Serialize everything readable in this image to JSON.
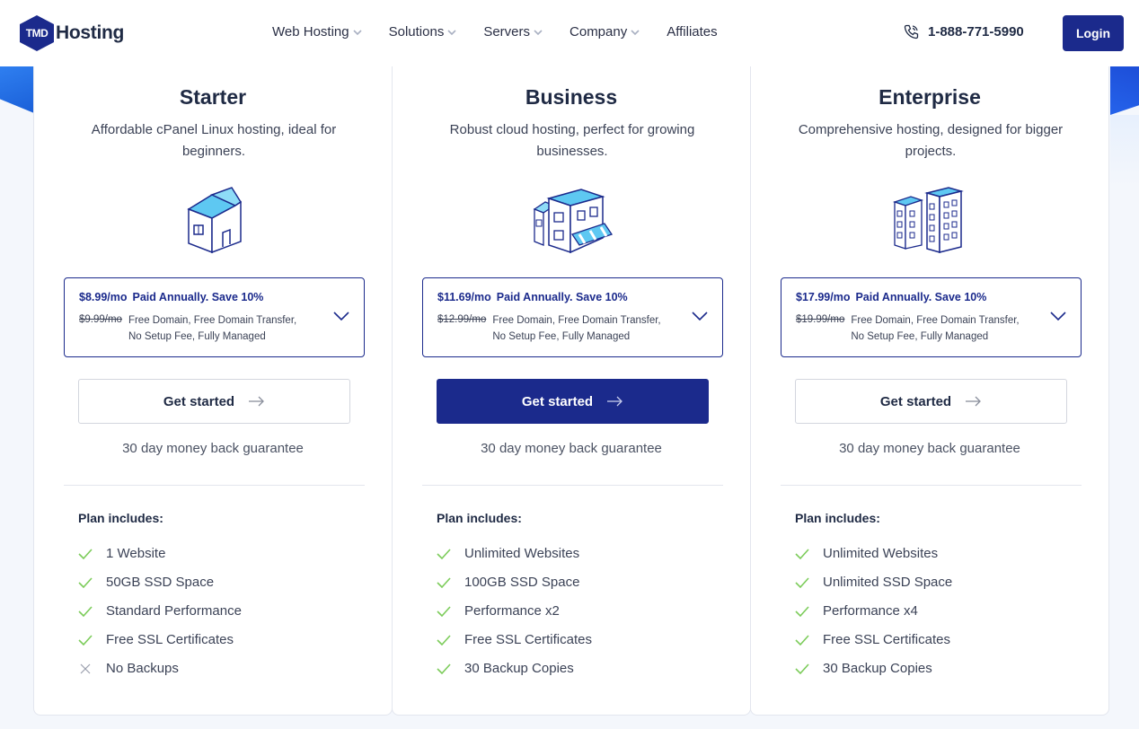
{
  "brand": {
    "logo_badge": "TMD",
    "logo_name": "Hosting"
  },
  "nav": [
    {
      "label": "Web Hosting",
      "has_dropdown": true
    },
    {
      "label": "Solutions",
      "has_dropdown": true
    },
    {
      "label": "Servers",
      "has_dropdown": true
    },
    {
      "label": "Company",
      "has_dropdown": true
    },
    {
      "label": "Affiliates",
      "has_dropdown": false
    }
  ],
  "phone": "1-888-771-5990",
  "login_label": "Login",
  "colors": {
    "brand": "#1b2a8c",
    "check": "#7ccc5a",
    "cross": "#9aa0ad"
  },
  "plans": [
    {
      "title": "Starter",
      "description": "Affordable cPanel Linux hosting, ideal for beginners.",
      "illustration": "house-icon",
      "price": "$8.99/mo",
      "billing": "Paid Annually. Save 10%",
      "old_price": "$9.99/mo",
      "perks": "Free Domain, Free Domain Transfer, No Setup Fee, Fully Managed",
      "cta": "Get started",
      "guarantee": "30 day money back guarantee",
      "includes_label": "Plan includes:",
      "features": [
        {
          "label": "1 Website",
          "included": true
        },
        {
          "label": "50GB SSD Space",
          "included": true
        },
        {
          "label": "Standard Performance",
          "included": true
        },
        {
          "label": "Free SSL Certificates",
          "included": true
        },
        {
          "label": "No Backups",
          "included": false
        }
      ]
    },
    {
      "title": "Business",
      "description": "Robust cloud hosting, perfect for growing businesses.",
      "illustration": "storefront-icon",
      "price": "$11.69/mo",
      "billing": "Paid Annually. Save 10%",
      "old_price": "$12.99/mo",
      "perks": "Free Domain, Free Domain Transfer, No Setup Fee, Fully Managed",
      "cta": "Get started",
      "guarantee": "30 day money back guarantee",
      "includes_label": "Plan includes:",
      "features": [
        {
          "label": "Unlimited Websites",
          "included": true
        },
        {
          "label": "100GB SSD Space",
          "included": true
        },
        {
          "label": "Performance x2",
          "included": true
        },
        {
          "label": "Free SSL Certificates",
          "included": true
        },
        {
          "label": "30 Backup Copies",
          "included": true
        }
      ]
    },
    {
      "title": "Enterprise",
      "description": "Comprehensive hosting, designed for bigger projects.",
      "illustration": "office-buildings-icon",
      "price": "$17.99/mo",
      "billing": "Paid Annually. Save 10%",
      "old_price": "$19.99/mo",
      "perks": "Free Domain, Free Domain Transfer, No Setup Fee, Fully Managed",
      "cta": "Get started",
      "guarantee": "30 day money back guarantee",
      "includes_label": "Plan includes:",
      "features": [
        {
          "label": "Unlimited Websites",
          "included": true
        },
        {
          "label": "Unlimited SSD Space",
          "included": true
        },
        {
          "label": "Performance x4",
          "included": true
        },
        {
          "label": "Free SSL Certificates",
          "included": true
        },
        {
          "label": "30 Backup Copies",
          "included": true
        }
      ]
    }
  ]
}
